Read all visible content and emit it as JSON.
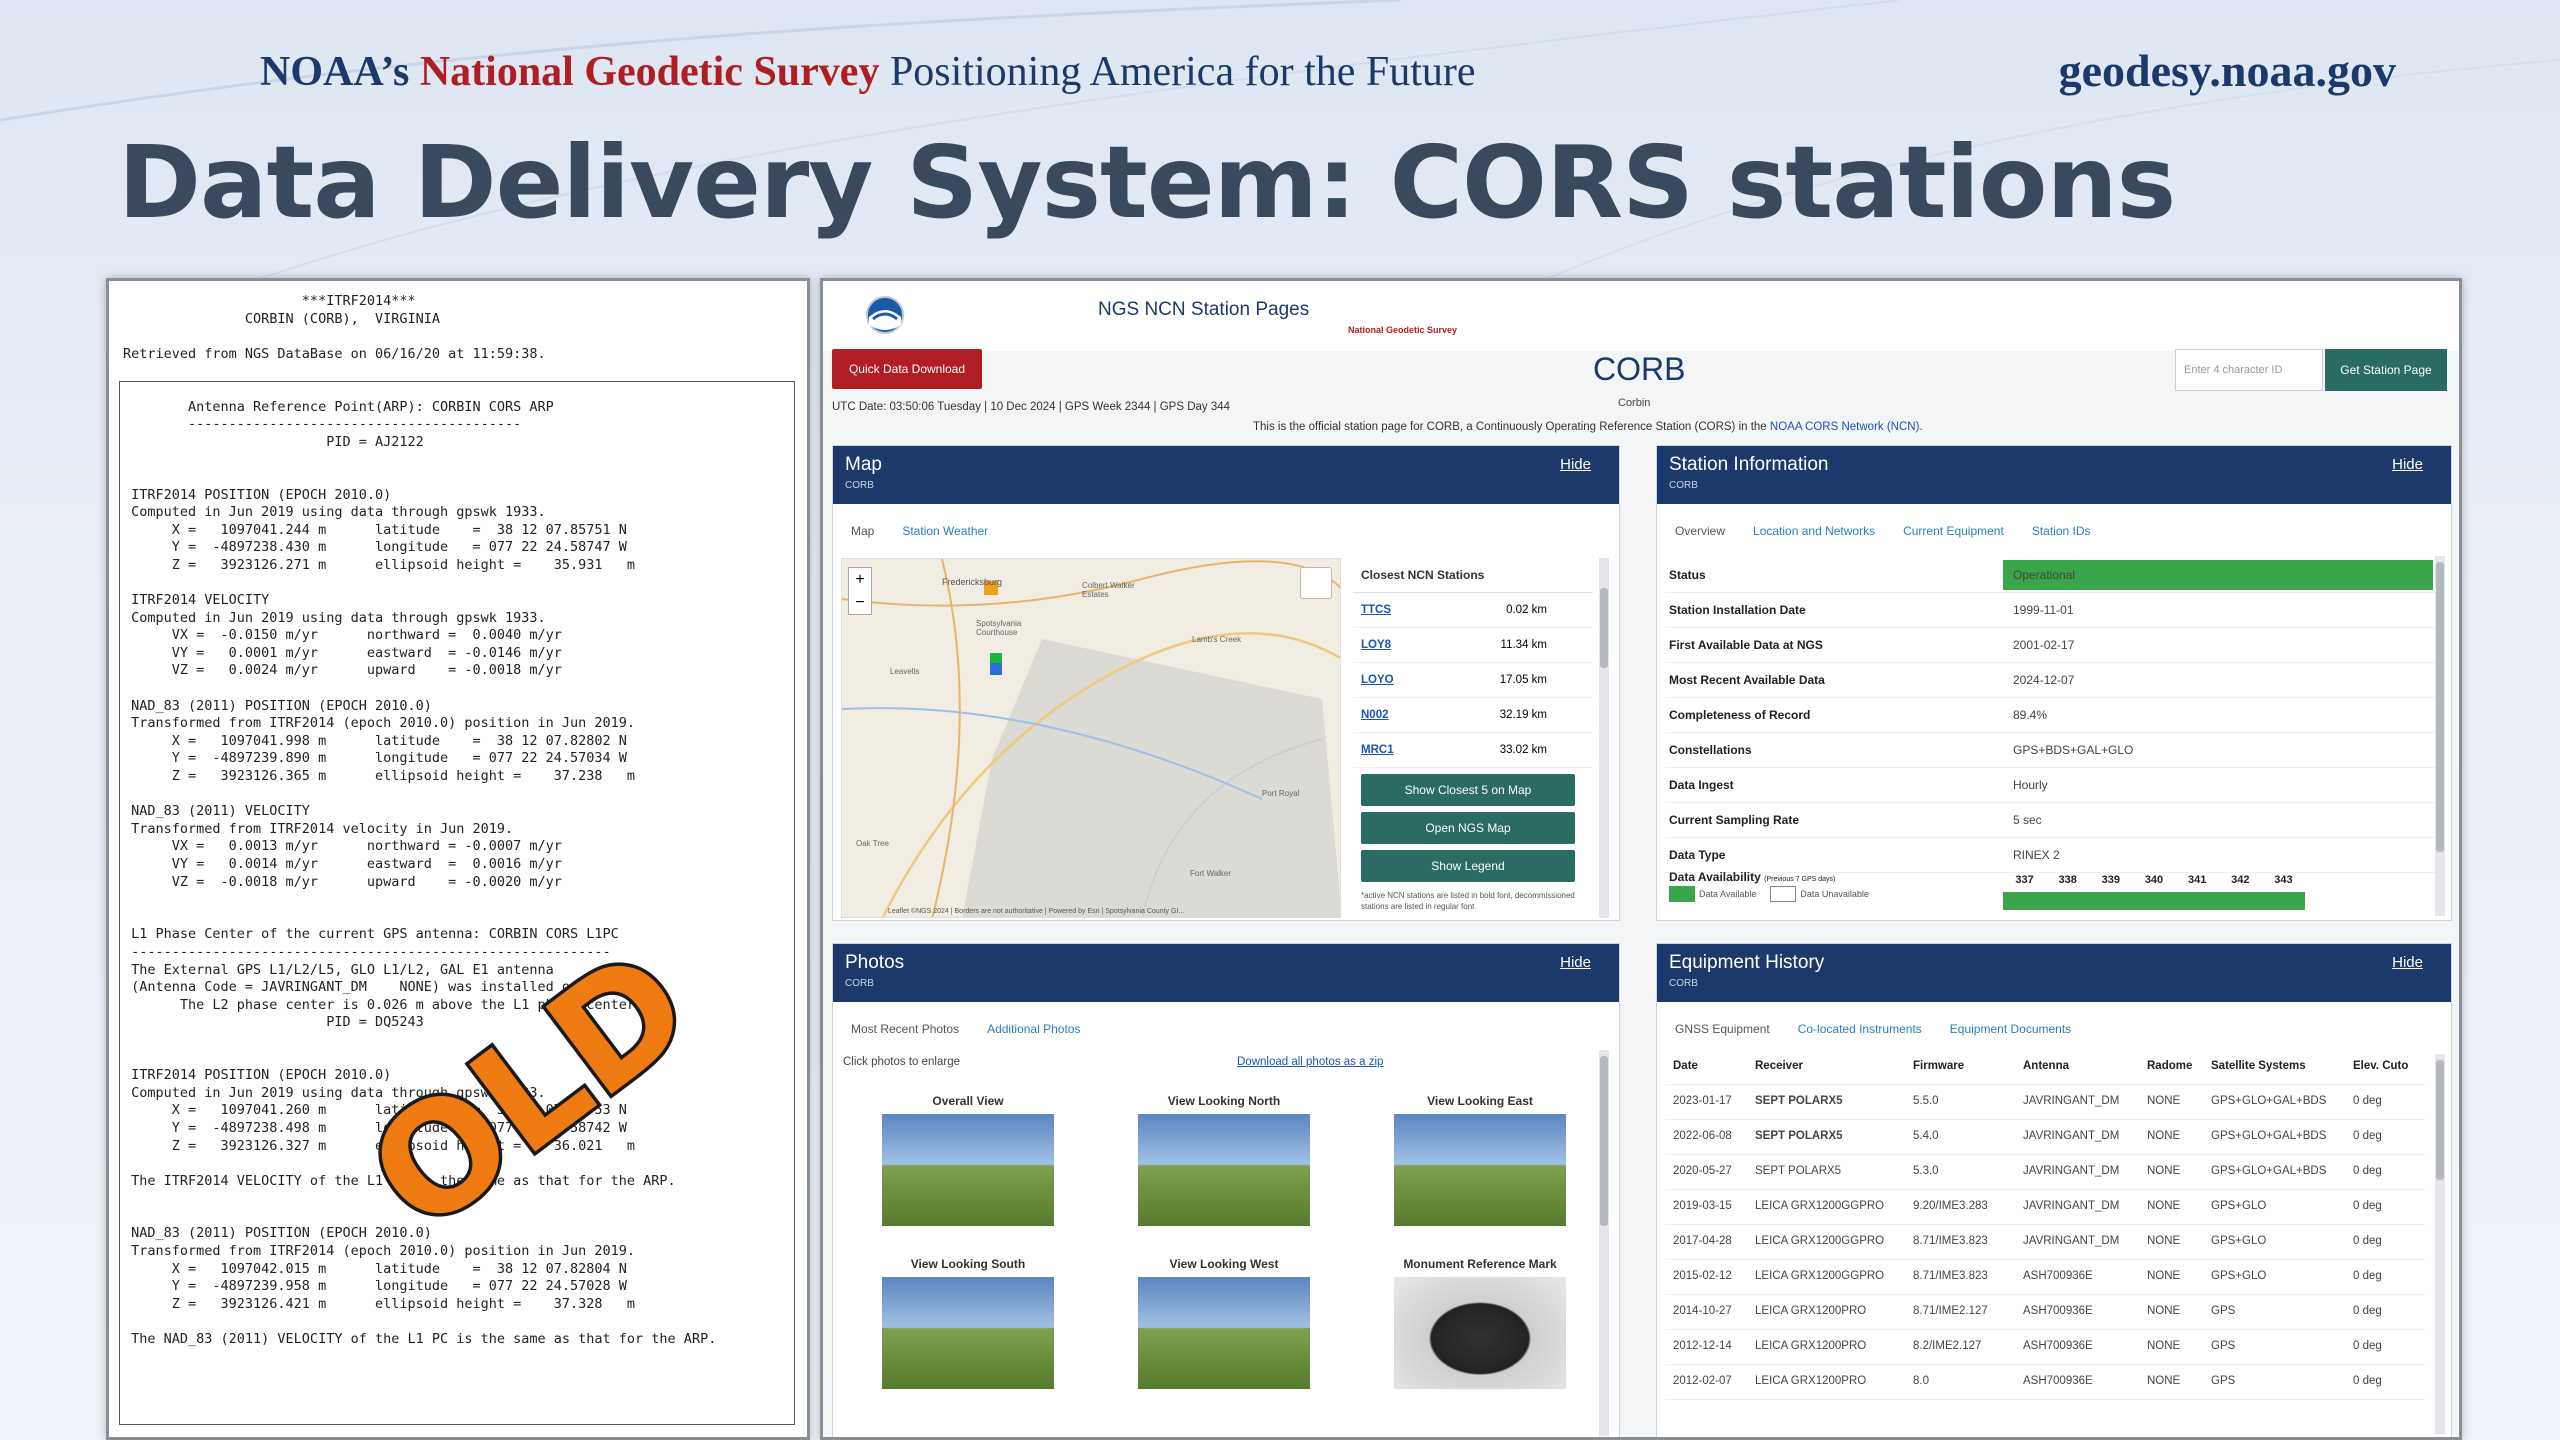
{
  "header": {
    "noaa": "NOAA’s",
    "ngs": "National Geodetic Survey",
    "tagline": "Positioning America for the Future",
    "url": "geodesy.noaa.gov"
  },
  "title": "Data Delivery System:  CORS stations",
  "datasheet_lines": [
    "                      ***ITRF2014***",
    "               CORBIN (CORB),  VIRGINIA",
    "",
    "Retrieved from NGS DataBase on 06/16/20 at 11:59:38.",
    "",
    "",
    "        Antenna Reference Point(ARP): CORBIN CORS ARP",
    "        -----------------------------------------",
    "                         PID = AJ2122",
    "",
    "",
    " ITRF2014 POSITION (EPOCH 2010.0)",
    " Computed in Jun 2019 using data through gpswk 1933.",
    "      X =   1097041.244 m      latitude    =  38 12 07.85751 N",
    "      Y =  -4897238.430 m      longitude   = 077 22 24.58747 W",
    "      Z =   3923126.271 m      ellipsoid height =    35.931   m",
    "",
    " ITRF2014 VELOCITY",
    " Computed in Jun 2019 using data through gpswk 1933.",
    "      VX =  -0.0150 m/yr      northward =  0.0040 m/yr",
    "      VY =   0.0001 m/yr      eastward  = -0.0146 m/yr",
    "      VZ =   0.0024 m/yr      upward    = -0.0018 m/yr",
    "",
    " NAD_83 (2011) POSITION (EPOCH 2010.0)",
    " Transformed from ITRF2014 (epoch 2010.0) position in Jun 2019.",
    "      X =   1097041.998 m      latitude    =  38 12 07.82802 N",
    "      Y =  -4897239.890 m      longitude   = 077 22 24.57034 W",
    "      Z =   3923126.365 m      ellipsoid height =    37.238   m",
    "",
    " NAD_83 (2011) VELOCITY",
    " Transformed from ITRF2014 velocity in Jun 2019.",
    "      VX =   0.0013 m/yr      northward = -0.0007 m/yr",
    "      VY =   0.0014 m/yr      eastward  =  0.0016 m/yr",
    "      VZ =  -0.0018 m/yr      upward    = -0.0020 m/yr",
    "",
    "",
    " L1 Phase Center of the current GPS antenna: CORBIN CORS L1PC",
    " -----------------------------------------------------------",
    " The External GPS L1/L2/L5, GLO L1/L2, GAL E1 antenna",
    " (Antenna Code = JAVRINGANT_DM    NONE) was installed on 28Apr2017.",
    "       The L2 phase center is 0.026 m above the L1 phase center.",
    "                         PID = DQ5243",
    "",
    "",
    " ITRF2014 POSITION (EPOCH 2010.0)",
    " Computed in Jun 2019 using data through gpswk 1933.",
    "      X =   1097041.260 m      latitude    =  38 12 07.85753 N",
    "      Y =  -4897238.498 m      longitude   = 077 22 24.58742 W",
    "      Z =   3923126.327 m      ellipsoid height =    36.021   m",
    "",
    " The ITRF2014 VELOCITY of the L1 PC is the same as that for the ARP.",
    "",
    "",
    " NAD_83 (2011) POSITION (EPOCH 2010.0)",
    " Transformed from ITRF2014 (epoch 2010.0) position in Jun 2019.",
    "      X =   1097042.015 m      latitude    =  38 12 07.82804 N",
    "      Y =  -4897239.958 m      longitude   = 077 22 24.57028 W",
    "      Z =   3923126.421 m      ellipsoid height =    37.328   m",
    "",
    " The NAD_83 (2011) VELOCITY of the L1 PC is the same as that for the ARP."
  ],
  "stamp": "OLD",
  "ncn": {
    "site_name": "NGS NCN Station Pages",
    "site_sub": "National Geodetic Survey",
    "quick_download": "Quick Data Download",
    "station": "CORB",
    "station_sub": "Corbin",
    "search_placeholder": "Enter 4 character ID",
    "get_station": "Get Station Page",
    "utc": "UTC Date: 03:50:06 Tuesday | 10 Dec 2024 | GPS Week 2344 | GPS Day 344",
    "official_pre": "This is the official station page for CORB, a Continuously Operating Reference Station (CORS) in the ",
    "official_link": "NOAA CORS Network (NCN)",
    "official_post": "."
  },
  "map_card": {
    "title": "Map",
    "sub": "CORB",
    "hide": "Hide",
    "tabs": [
      "Map",
      "Station Weather"
    ],
    "places": [
      "Fredericksburg",
      "Colbert Walker Estates",
      "Spotsylvania Courthouse",
      "Lamb's Creek",
      "Leavells",
      "Port Royal",
      "Fort Walker",
      "Oak Tree"
    ],
    "attribution": "Leaflet ©NGS 2024 | Borders are not authoritative | Powered by Esri | Spotsylvania County GI...",
    "closest_title": "Closest NCN Stations",
    "closest": [
      {
        "id": "TTCS",
        "dist": "0.02 km"
      },
      {
        "id": "LOY8",
        "dist": "11.34 km"
      },
      {
        "id": "LOYO",
        "dist": "17.05 km"
      },
      {
        "id": "N002",
        "dist": "32.19 km"
      },
      {
        "id": "MRC1",
        "dist": "33.02 km"
      }
    ],
    "btn_closest": "Show Closest 5 on Map",
    "btn_open": "Open NGS Map",
    "btn_legend": "Show Legend",
    "note": "*active NCN stations are listed in bold font, decommissioned stations are listed in regular font"
  },
  "info_card": {
    "title": "Station Information",
    "sub": "CORB",
    "hide": "Hide",
    "tabs": [
      "Overview",
      "Location and Networks",
      "Current Equipment",
      "Station IDs"
    ],
    "rows": [
      {
        "label": "Status",
        "value": "Operational"
      },
      {
        "label": "Station Installation Date",
        "value": "1999-11-01"
      },
      {
        "label": "First Available Data at NGS",
        "value": "2001-02-17"
      },
      {
        "label": "Most Recent Available Data",
        "value": "2024-12-07"
      },
      {
        "label": "Completeness of Record",
        "value": "89.4%"
      },
      {
        "label": "Constellations",
        "value": "GPS+BDS+GAL+GLO"
      },
      {
        "label": "Data Ingest",
        "value": "Hourly"
      },
      {
        "label": "Current Sampling Rate",
        "value": "5 sec"
      },
      {
        "label": "Data Type",
        "value": "RINEX 2"
      }
    ],
    "availability_label": "Data Availability",
    "availability_sub": "(Previous 7 GPS days)",
    "legend_available": "Data Available",
    "legend_unavailable": "Data Unavailable",
    "days": [
      "337",
      "338",
      "339",
      "340",
      "341",
      "342",
      "343"
    ]
  },
  "photos_card": {
    "title": "Photos",
    "sub": "CORB",
    "hide": "Hide",
    "tabs": [
      "Most Recent Photos",
      "Additional Photos"
    ],
    "hint": "Click photos to enlarge",
    "download": "Download all photos as a zip",
    "photos": [
      "Overall View",
      "View Looking North",
      "View Looking East",
      "View Looking South",
      "View Looking West",
      "Monument Reference Mark"
    ]
  },
  "equip_card": {
    "title": "Equipment History",
    "sub": "CORB",
    "hide": "Hide",
    "tabs": [
      "GNSS Equipment",
      "Co-located Instruments",
      "Equipment Documents"
    ],
    "headers": [
      "Date",
      "Receiver",
      "Firmware",
      "Antenna",
      "Radome",
      "Satellite Systems",
      "Elev. Cuto"
    ],
    "rows": [
      [
        "2023-01-17",
        "SEPT POLARX5",
        "5.5.0",
        "JAVRINGANT_DM",
        "NONE",
        "GPS+GLO+GAL+BDS",
        "0 deg"
      ],
      [
        "2022-06-08",
        "SEPT POLARX5",
        "5.4.0",
        "JAVRINGANT_DM",
        "NONE",
        "GPS+GLO+GAL+BDS",
        "0 deg"
      ],
      [
        "2020-05-27",
        "SEPT POLARX5",
        "5.3.0",
        "JAVRINGANT_DM",
        "NONE",
        "GPS+GLO+GAL+BDS",
        "0 deg"
      ],
      [
        "2019-03-15",
        "LEICA GRX1200GGPRO",
        "9.20/IME3.283",
        "JAVRINGANT_DM",
        "NONE",
        "GPS+GLO",
        "0 deg"
      ],
      [
        "2017-04-28",
        "LEICA GRX1200GGPRO",
        "8.71/IME3.823",
        "JAVRINGANT_DM",
        "NONE",
        "GPS+GLO",
        "0 deg"
      ],
      [
        "2015-02-12",
        "LEICA GRX1200GGPRO",
        "8.71/IME3.823",
        "ASH700936E",
        "NONE",
        "GPS+GLO",
        "0 deg"
      ],
      [
        "2014-10-27",
        "LEICA GRX1200PRO",
        "8.71/IME2.127",
        "ASH700936E",
        "NONE",
        "GPS",
        "0 deg"
      ],
      [
        "2012-12-14",
        "LEICA GRX1200PRO",
        "8.2/IME2.127",
        "ASH700936E",
        "NONE",
        "GPS",
        "0 deg"
      ],
      [
        "2012-02-07",
        "LEICA GRX1200PRO",
        "8.0",
        "ASH700936E",
        "NONE",
        "GPS",
        "0 deg"
      ]
    ]
  },
  "colors": {
    "navy": "#1b3a6b",
    "red": "#b01e23",
    "teal": "#2a6b63",
    "green": "#3aa54a",
    "stamp": "#f07a12"
  }
}
